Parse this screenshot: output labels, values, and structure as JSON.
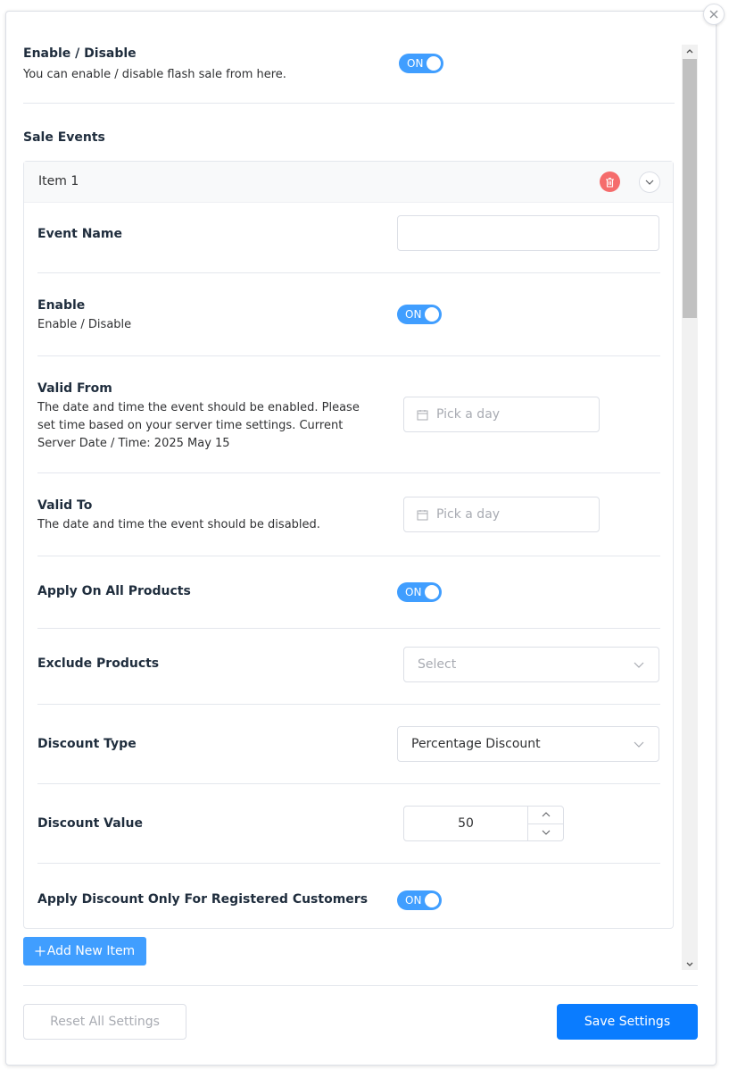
{
  "general": {
    "title": "Enable / Disable",
    "description": "You can enable / disable flash sale from here.",
    "toggle_label": "ON"
  },
  "sale_events": {
    "title": "Sale Events",
    "add_button_label": "Add New Item",
    "add_icon": "plus-icon",
    "items": [
      {
        "name": "Item 1",
        "fields": {
          "event_name": {
            "label": "Event Name",
            "value": ""
          },
          "enable": {
            "label": "Enable",
            "description": "Enable / Disable",
            "toggle_label": "ON"
          },
          "valid_from": {
            "label": "Valid From",
            "description": "The date and time the event should be enabled. Please set time based on your server time settings. Current Server Date / Time: 2025 May 15",
            "placeholder": "Pick a day"
          },
          "valid_to": {
            "label": "Valid To",
            "description": "The date and time the event should be disabled.",
            "placeholder": "Pick a day"
          },
          "apply_all": {
            "label": "Apply On All Products",
            "toggle_label": "ON"
          },
          "exclude_products": {
            "label": "Exclude Products",
            "placeholder": "Select"
          },
          "discount_type": {
            "label": "Discount Type",
            "value": "Percentage Discount"
          },
          "discount_value": {
            "label": "Discount Value",
            "value": "50"
          },
          "registered_only": {
            "label": "Apply Discount Only For Registered Customers",
            "toggle_label": "ON"
          }
        }
      }
    ]
  },
  "footer": {
    "reset_label": "Reset All Settings",
    "save_label": "Save Settings"
  },
  "colors": {
    "primary": "#409eff",
    "save": "#0a7cff",
    "danger": "#f56c6c"
  }
}
